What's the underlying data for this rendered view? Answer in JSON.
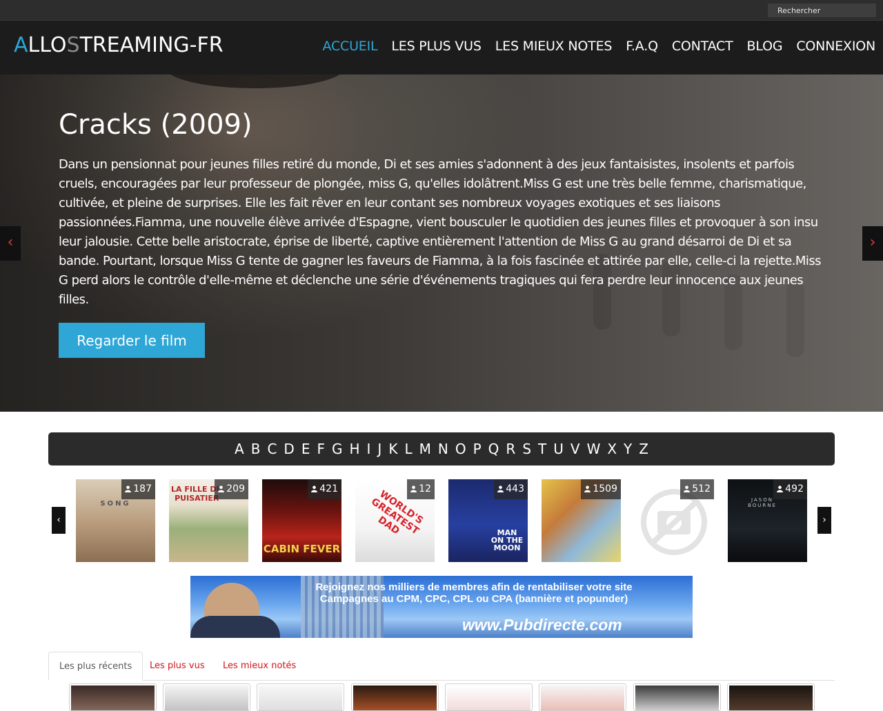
{
  "search": {
    "placeholder": "Rechercher"
  },
  "logo": {
    "part_a": "A",
    "part_llo": "LLO",
    "part_s": "S",
    "part_rest": "TREAMING-FR"
  },
  "nav": [
    {
      "label": "ACCUEIL",
      "active": true
    },
    {
      "label": "LES PLUS VUS",
      "active": false
    },
    {
      "label": "LES MIEUX NOTES",
      "active": false
    },
    {
      "label": "F.A.Q",
      "active": false
    },
    {
      "label": "CONTACT",
      "active": false
    },
    {
      "label": "BLOG",
      "active": false
    },
    {
      "label": "CONNEXION",
      "active": false
    }
  ],
  "hero": {
    "title": "Cracks (2009)",
    "synopsis": "Dans un pensionnat pour jeunes filles retiré du monde, Di et ses amies s'adonnent à des jeux fantaisistes, insolents et parfois cruels, encouragées par leur professeur de plongée, miss G, qu'elles idolâtrent.Miss G est une très belle femme, charismatique, cultivée, et pleine de surprises. Elle les fait rêver en leur contant ses nombreux voyages exotiques et ses liaisons passionnées.Fiamma, une nouvelle élève arrivée d'Espagne, vient bousculer le quotidien des jeunes filles et provoquer à son insu leur jalousie. Cette belle aristocrate, éprise de liberté, captive entièrement l'attention de Miss G au grand désarroi de Di et sa bande. Pourtant, lorsque Miss G tente de gagner les faveurs de Fiamma, à la fois fascinée et attirée par elle, celle-ci la rejette.Miss G perd alors le contrôle d'elle-même et déclenche une série d'événements tragiques qui fera perdre leur innocence aux jeunes filles.",
    "button": "Regarder le film",
    "prev_icon": "‹",
    "next_icon": "›"
  },
  "alphabet": [
    "A",
    "B",
    "C",
    "D",
    "E",
    "F",
    "G",
    "H",
    "I",
    "J",
    "K",
    "L",
    "M",
    "N",
    "O",
    "P",
    "Q",
    "R",
    "S",
    "T",
    "U",
    "V",
    "W",
    "X",
    "Y",
    "Z"
  ],
  "carousel": {
    "prev_icon": "‹",
    "next_icon": "›",
    "items": [
      {
        "views": "187",
        "poster_text": "SONG"
      },
      {
        "views": "209",
        "poster_text": "LA FILLE DU PUISATIER"
      },
      {
        "views": "421",
        "poster_text": "CABIN FEVER"
      },
      {
        "views": "12",
        "poster_text": "WORLD'S GREATEST DAD"
      },
      {
        "views": "443",
        "poster_text": "MAN ON THE MOON"
      },
      {
        "views": "1509",
        "poster_text": ""
      },
      {
        "views": "512",
        "poster_text": ""
      },
      {
        "views": "492",
        "poster_text": "JASON BOURNE"
      }
    ]
  },
  "ad": {
    "line1": "Rejoignez nos milliers de membres afin de rentabiliser votre site",
    "line2": "Campagnes au CPM, CPC, CPL ou CPA (bannière et popunder)",
    "url": "www.Pubdirecte.com"
  },
  "tabs": [
    {
      "label": "Les plus récents",
      "active": true
    },
    {
      "label": "Les plus vus",
      "active": false
    },
    {
      "label": "Les mieux notés",
      "active": false
    }
  ],
  "colors": {
    "accent": "#2ea6d6",
    "tab_link": "#d2141b",
    "header_bg": "#1c1c1c",
    "topbar_bg": "#2d2d2d"
  }
}
